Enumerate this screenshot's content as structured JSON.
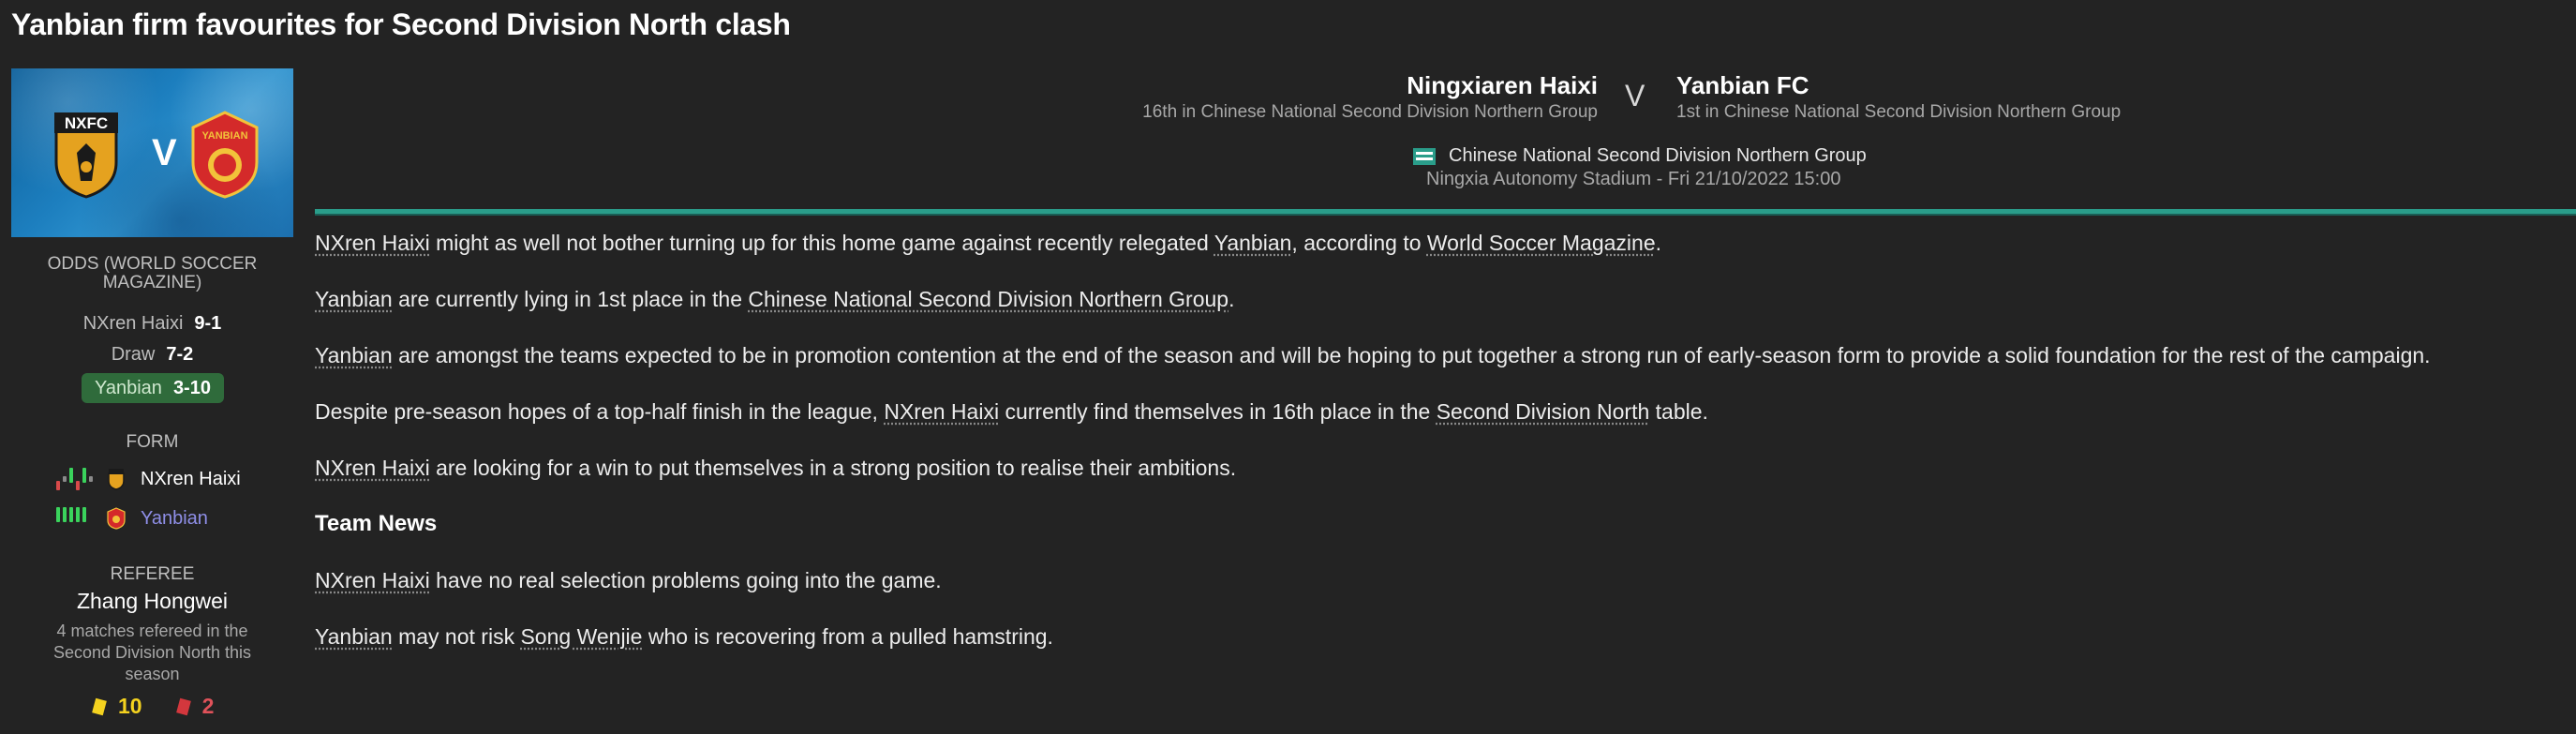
{
  "headline": "Yanbian firm favourites for Second Division North clash",
  "match_image": {
    "home_crest_label": "NXFC",
    "away_crest_label": "YANBIAN",
    "vs": "V"
  },
  "odds": {
    "title": "ODDS (WORLD SOCCER MAGAZINE)",
    "rows": [
      {
        "label": "NXren Haixi",
        "value": "9-1"
      },
      {
        "label": "Draw",
        "value": "7-2"
      },
      {
        "label": "Yanbian",
        "value": "3-10",
        "highlight_color": "#2f6b3b"
      }
    ]
  },
  "form": {
    "title": "FORM",
    "teams": [
      {
        "name": "NXren Haixi",
        "results": [
          "L",
          "D",
          "W",
          "L",
          "W",
          "D"
        ],
        "crest_icon": "nxfc-crest-icon"
      },
      {
        "name": "Yanbian",
        "results": [
          "W",
          "W",
          "W",
          "W",
          "W"
        ],
        "crest_icon": "yanbian-crest-icon",
        "name_color": "#8f8fe8"
      }
    ],
    "colors": {
      "W": "#3ad35c",
      "D": "#8a8a8a",
      "L": "#d84a4a"
    }
  },
  "referee": {
    "title": "REFEREE",
    "name": "Zhang Hongwei",
    "info": "4 matches refereed in the Second Division North this season",
    "yellow_cards": "10",
    "red_cards": "2"
  },
  "match": {
    "home_team": "Ningxiaren Haixi",
    "home_position": "16th in Chinese National Second Division Northern Group",
    "vs": "V",
    "away_team": "Yanbian FC",
    "away_position": "1st in Chinese National Second Division Northern Group",
    "competition": "Chinese National Second Division Northern Group",
    "venue": "Ningxia Autonomy Stadium - Fri 21/10/2022 15:00",
    "accent_color": "#2a9d8a"
  },
  "article": {
    "p1": [
      "NXren Haixi",
      " might as well not bother turning up for this home game against recently relegated ",
      "Yanbian",
      ", according to ",
      "World Soccer Magazine",
      "."
    ],
    "p2": [
      "Yanbian",
      " are currently lying in 1st place in the ",
      "Chinese National Second Division Northern Group",
      "."
    ],
    "p3": [
      "Yanbian",
      " are amongst the teams expected to be in promotion contention at the end of the season and will be hoping to put together a strong run of early-season form to provide a solid foundation for the rest of the campaign."
    ],
    "p4": [
      "Despite pre-season hopes of a top-half finish in the league, ",
      "NXren Haixi",
      " currently find themselves in 16th place in the ",
      "Second Division North",
      " table."
    ],
    "p5": [
      "NXren Haixi",
      " are looking for a win to put themselves in a strong position to realise their ambitions."
    ],
    "team_news_heading": "Team News",
    "p6": [
      "NXren Haixi",
      " have no real selection problems going into the game."
    ],
    "p7": [
      "Yanbian",
      " may not risk ",
      "Song Wenjie",
      " who is recovering from a pulled hamstring."
    ]
  }
}
